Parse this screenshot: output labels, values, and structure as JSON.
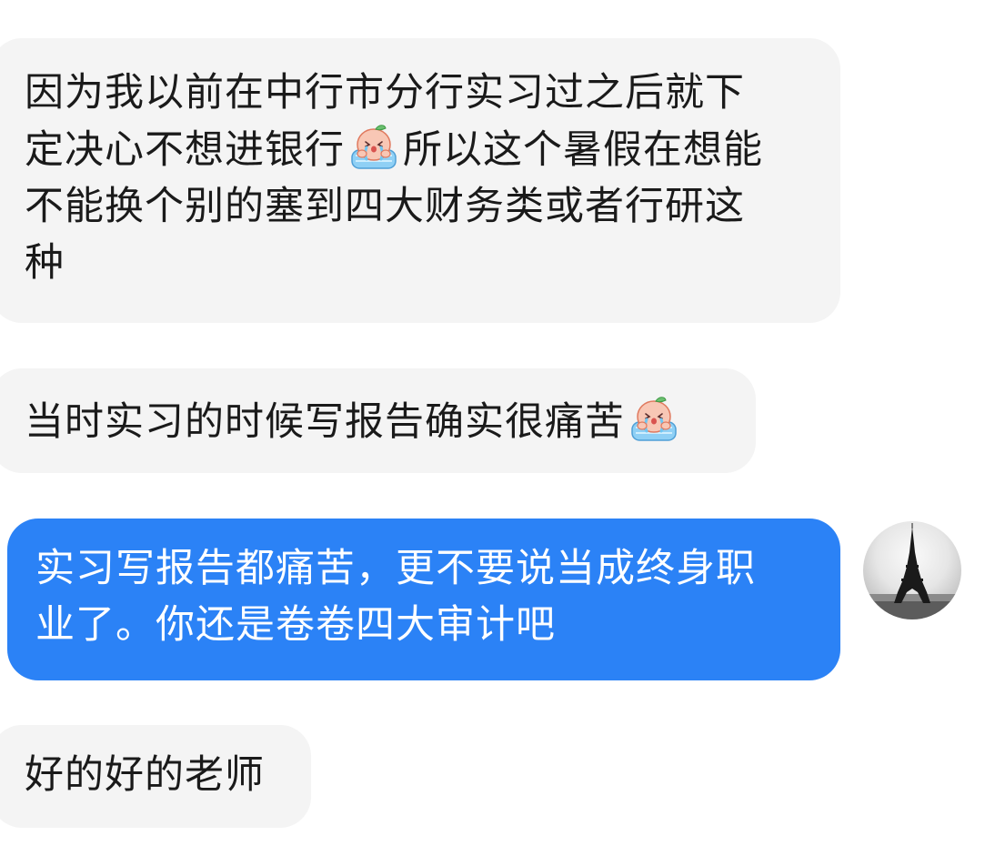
{
  "chat": {
    "messages": [
      {
        "sender": "other",
        "lines": [
          "因为我以前在中行市分行实习过之后就下",
          "定决心不想进银行",
          "所以这个暑假在想能",
          "不能换个别的塞到四大财务类或者行研这",
          "种"
        ]
      },
      {
        "sender": "other",
        "lines": [
          "当时实习的时候写报告确实很痛苦"
        ]
      },
      {
        "sender": "me",
        "lines": [
          "实习写报告都痛苦，更不要说当成终身职",
          "业了。你还是卷卷四大审计吧"
        ]
      },
      {
        "sender": "other",
        "lines": [
          "好的好的老师"
        ]
      }
    ],
    "emoji_icon": "crying-peach-sticker-icon",
    "avatar_icon": "eiffel-tower-avatar",
    "colors": {
      "incoming_bubble": "#f4f4f4",
      "outgoing_bubble": "#2b82f6",
      "incoming_text": "#1a1a1a",
      "outgoing_text": "#ffffff"
    }
  }
}
